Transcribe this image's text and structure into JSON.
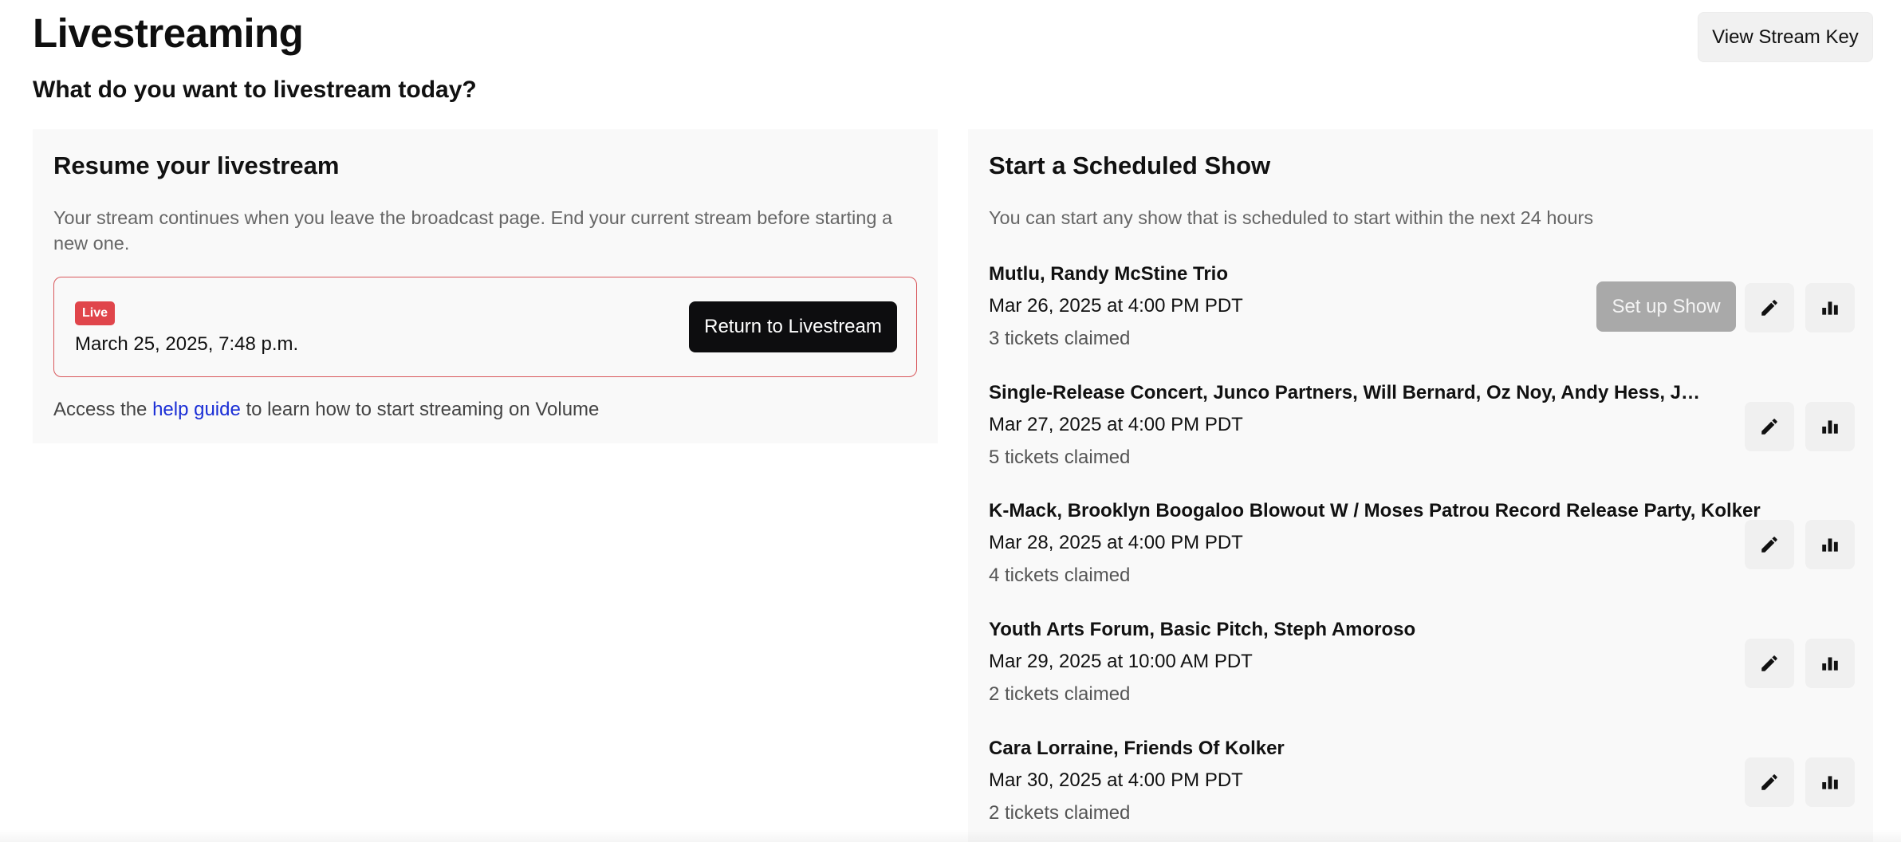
{
  "header": {
    "title": "Livestreaming",
    "subtitle": "What do you want to livestream today?",
    "stream_key_label": "View Stream Key"
  },
  "resume": {
    "title": "Resume your livestream",
    "description": "Your stream continues when you leave the broadcast page. End your current stream before starting a new one.",
    "live_badge": "Live",
    "date": "March 25, 2025, 7:48 p.m.",
    "return_label": "Return to Livestream",
    "help_prefix": "Access the",
    "help_link": "help guide",
    "help_suffix": "to learn how to start streaming on Volume"
  },
  "scheduled": {
    "title": "Start a Scheduled Show",
    "description": "You can start any show that is scheduled to start within the next 24 hours",
    "setup_label": "Set up Show",
    "shows": [
      {
        "title": "Mutlu, Randy McStine Trio",
        "date": "Mar 26, 2025 at 4:00 PM PDT",
        "tickets": "3 tickets claimed"
      },
      {
        "title": "Single-Release Concert, Junco Partners, Will Bernard, Oz Noy, Andy Hess, Josh…",
        "date": "Mar 27, 2025 at 4:00 PM PDT",
        "tickets": "5 tickets claimed"
      },
      {
        "title": "K-Mack, Brooklyn Boogaloo Blowout W / Moses Patrou Record Release Party, Kolker",
        "date": "Mar 28, 2025 at 4:00 PM PDT",
        "tickets": "4 tickets claimed"
      },
      {
        "title": "Youth Arts Forum, Basic Pitch, Steph Amoroso",
        "date": "Mar 29, 2025 at 10:00 AM PDT",
        "tickets": "2 tickets claimed"
      },
      {
        "title": "Cara Lorraine, Friends Of Kolker",
        "date": "Mar 30, 2025 at 4:00 PM PDT",
        "tickets": "2 tickets claimed"
      }
    ]
  },
  "icons": {
    "edit": "pencil-icon",
    "stats": "bar-chart-icon"
  },
  "colors": {
    "live_red": "#e0454b",
    "live_border": "#d9585c",
    "primary_button": "#0d0d0f",
    "disabled_button": "#a9a9a9",
    "link": "#1a2ed6",
    "panel_bg": "#f9f9f9"
  }
}
